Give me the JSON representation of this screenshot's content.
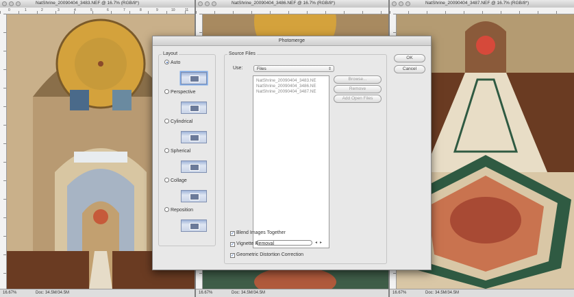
{
  "windows": [
    {
      "title": "NatShrine_20090404_3483.NEF @ 16.7% (RGB/8*)",
      "zoom": "16.67%",
      "doc": "Doc: 34.5M/34.5M"
    },
    {
      "title": "NatShrine_20090404_3486.NEF @ 16.7% (RGB/8*)",
      "zoom": "16.67%",
      "doc": "Doc: 34.5M/34.5M"
    },
    {
      "title": "NatShrine_20090404_3487.NEF @ 16.7% (RGB/8*)",
      "zoom": "16.67%",
      "doc": "Doc: 34.5M/34.5M"
    }
  ],
  "dialog": {
    "title": "Photomerge",
    "layout": {
      "label": "Layout",
      "options": [
        {
          "label": "Auto",
          "selected": true
        },
        {
          "label": "Perspective",
          "selected": false
        },
        {
          "label": "Cylindrical",
          "selected": false
        },
        {
          "label": "Spherical",
          "selected": false
        },
        {
          "label": "Collage",
          "selected": false
        },
        {
          "label": "Reposition",
          "selected": false
        }
      ]
    },
    "source": {
      "label": "Source Files",
      "use_label": "Use:",
      "use_value": "Files",
      "files": [
        "NatShrine_20090404_3483.NE",
        "NatShrine_20090404_3486.NE",
        "NatShrine_20090404_3487.NE"
      ],
      "browse": "Browse...",
      "remove": "Remove",
      "add_open": "Add Open Files"
    },
    "options": [
      {
        "label": "Blend Images Together",
        "checked": true
      },
      {
        "label": "Vignette Removal",
        "checked": true
      },
      {
        "label": "Geometric Distortion Correction",
        "checked": true
      }
    ],
    "ok": "OK",
    "cancel": "Cancel"
  },
  "ruler_ticks": [
    "0",
    "1",
    "2",
    "3",
    "4",
    "5",
    "6",
    "7",
    "8",
    "9",
    "10",
    "11"
  ],
  "colors": {
    "accent": "#2a5aa8",
    "gold": "#d4a23c",
    "marble": "#d9c7a6",
    "pew": "#6a3b22",
    "dialog_bg": "#e8e8e8"
  }
}
